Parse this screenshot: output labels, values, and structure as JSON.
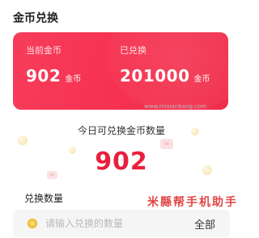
{
  "section_title": "金币兑换",
  "balance_card": {
    "current_label": "当前金币",
    "current_value": "902",
    "current_unit": "金币",
    "redeemed_label": "已兑换",
    "redeemed_value": "201000",
    "redeemed_unit": "金币",
    "accent": "#f5314f"
  },
  "today": {
    "label": "今日可兑换金币数量",
    "value": "902",
    "value_color": "#e8203d"
  },
  "quantity": {
    "label": "兑换数量",
    "placeholder": "请输入兑换的数量",
    "value": "",
    "all_button": "全部",
    "icon": "coin-icon"
  },
  "watermark": {
    "text": "米縣帮手机助手",
    "url": "www.mixianbang.com"
  }
}
